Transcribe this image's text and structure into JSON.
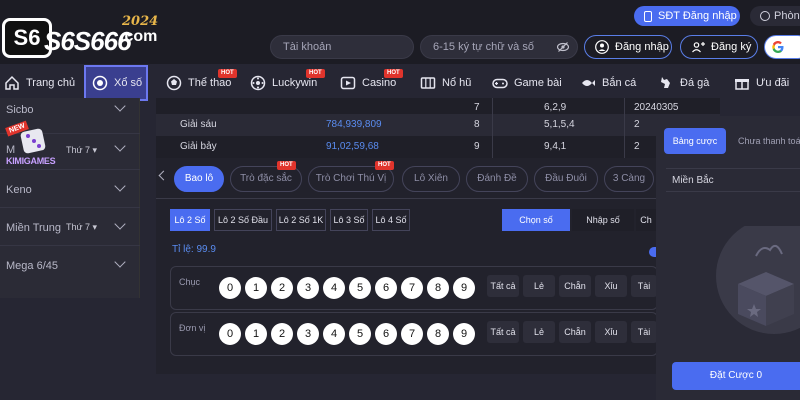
{
  "header": {
    "logo_brand": "S6S666",
    "logo_year": "2024",
    "logo_suffix": ".com",
    "account_placeholder": "Tài khoản",
    "password_placeholder": "6-15 ký tự chữ và số",
    "sdt_login": "SĐT Đăng nhập",
    "room_label": "Phòng",
    "login": "Đăng nhập",
    "register": "Đăng ký"
  },
  "nav": [
    {
      "label": "Trang chủ",
      "hot": false
    },
    {
      "label": "Xổ số",
      "hot": false
    },
    {
      "label": "Thể thao",
      "hot": true
    },
    {
      "label": "Luckywin",
      "hot": true
    },
    {
      "label": "Casino",
      "hot": true
    },
    {
      "label": "Nổ hũ",
      "hot": false
    },
    {
      "label": "Game bài",
      "hot": false
    },
    {
      "label": "Bắn cá",
      "hot": false
    },
    {
      "label": "Đá gà",
      "hot": false
    },
    {
      "label": "Ưu đãi",
      "hot": false
    }
  ],
  "hot_label": "HOT",
  "sidebar": {
    "rows": [
      {
        "label": "Sicbo",
        "sub": ""
      },
      {
        "label": "M",
        "sub": "Thứ 7 ▾"
      },
      {
        "label": "Keno",
        "sub": ""
      },
      {
        "label": "Miền Trung",
        "sub": "Thứ 7 ▾"
      },
      {
        "label": "Mega 6/45",
        "sub": ""
      }
    ],
    "badge_new": "NEW",
    "kimi_label": "KIMIGAMES"
  },
  "results": {
    "rows": [
      {
        "prize": "",
        "numbers": "",
        "index": "7",
        "tail": "6,2,9",
        "date": "20240305"
      },
      {
        "prize": "Giải sáu",
        "numbers": "784,939,809",
        "index": "8",
        "tail": "5,1,5,4",
        "date": "2"
      },
      {
        "prize": "Giải bảy",
        "numbers": "91,02,59,68",
        "index": "9",
        "tail": "9,4,1",
        "date": "2"
      }
    ]
  },
  "game": {
    "tabs": [
      {
        "label": "Bao lô",
        "hot": false
      },
      {
        "label": "Trò đặc sắc",
        "hot": true
      },
      {
        "label": "Trò Chơi Thú Vị",
        "hot": true
      },
      {
        "label": "Lô Xiên",
        "hot": false
      },
      {
        "label": "Đánh Đề",
        "hot": false
      },
      {
        "label": "Đầu Đuôi",
        "hot": false
      },
      {
        "label": "3 Càng",
        "hot": false
      }
    ],
    "sub_tabs": [
      "Lô 2 Số",
      "Lô 2 Số Đầu",
      "Lô 2 Số 1K",
      "Lô 3 Số",
      "Lô 4 Số"
    ],
    "modes": [
      "Chọn số",
      "Nhập số",
      "Ch"
    ],
    "odds": "Tỉ lệ: 99.9",
    "rows": [
      {
        "label": "Chục"
      },
      {
        "label": "Đơn vị"
      }
    ],
    "digits": [
      "0",
      "1",
      "2",
      "3",
      "4",
      "5",
      "6",
      "7",
      "8",
      "9"
    ],
    "quick": [
      "Tất cả",
      "Lẻ",
      "Chẵn",
      "Xỉu",
      "Tài"
    ]
  },
  "slip": {
    "tab_active": "Bảng cược",
    "tab_other": "Chưa thanh toán",
    "region": "Miền Bắc",
    "place_bet": "Đặt Cược 0"
  },
  "colors": {
    "accent": "#4a6cf0",
    "hot": "#e0342c",
    "result_numbers": "#5a8cf0"
  }
}
